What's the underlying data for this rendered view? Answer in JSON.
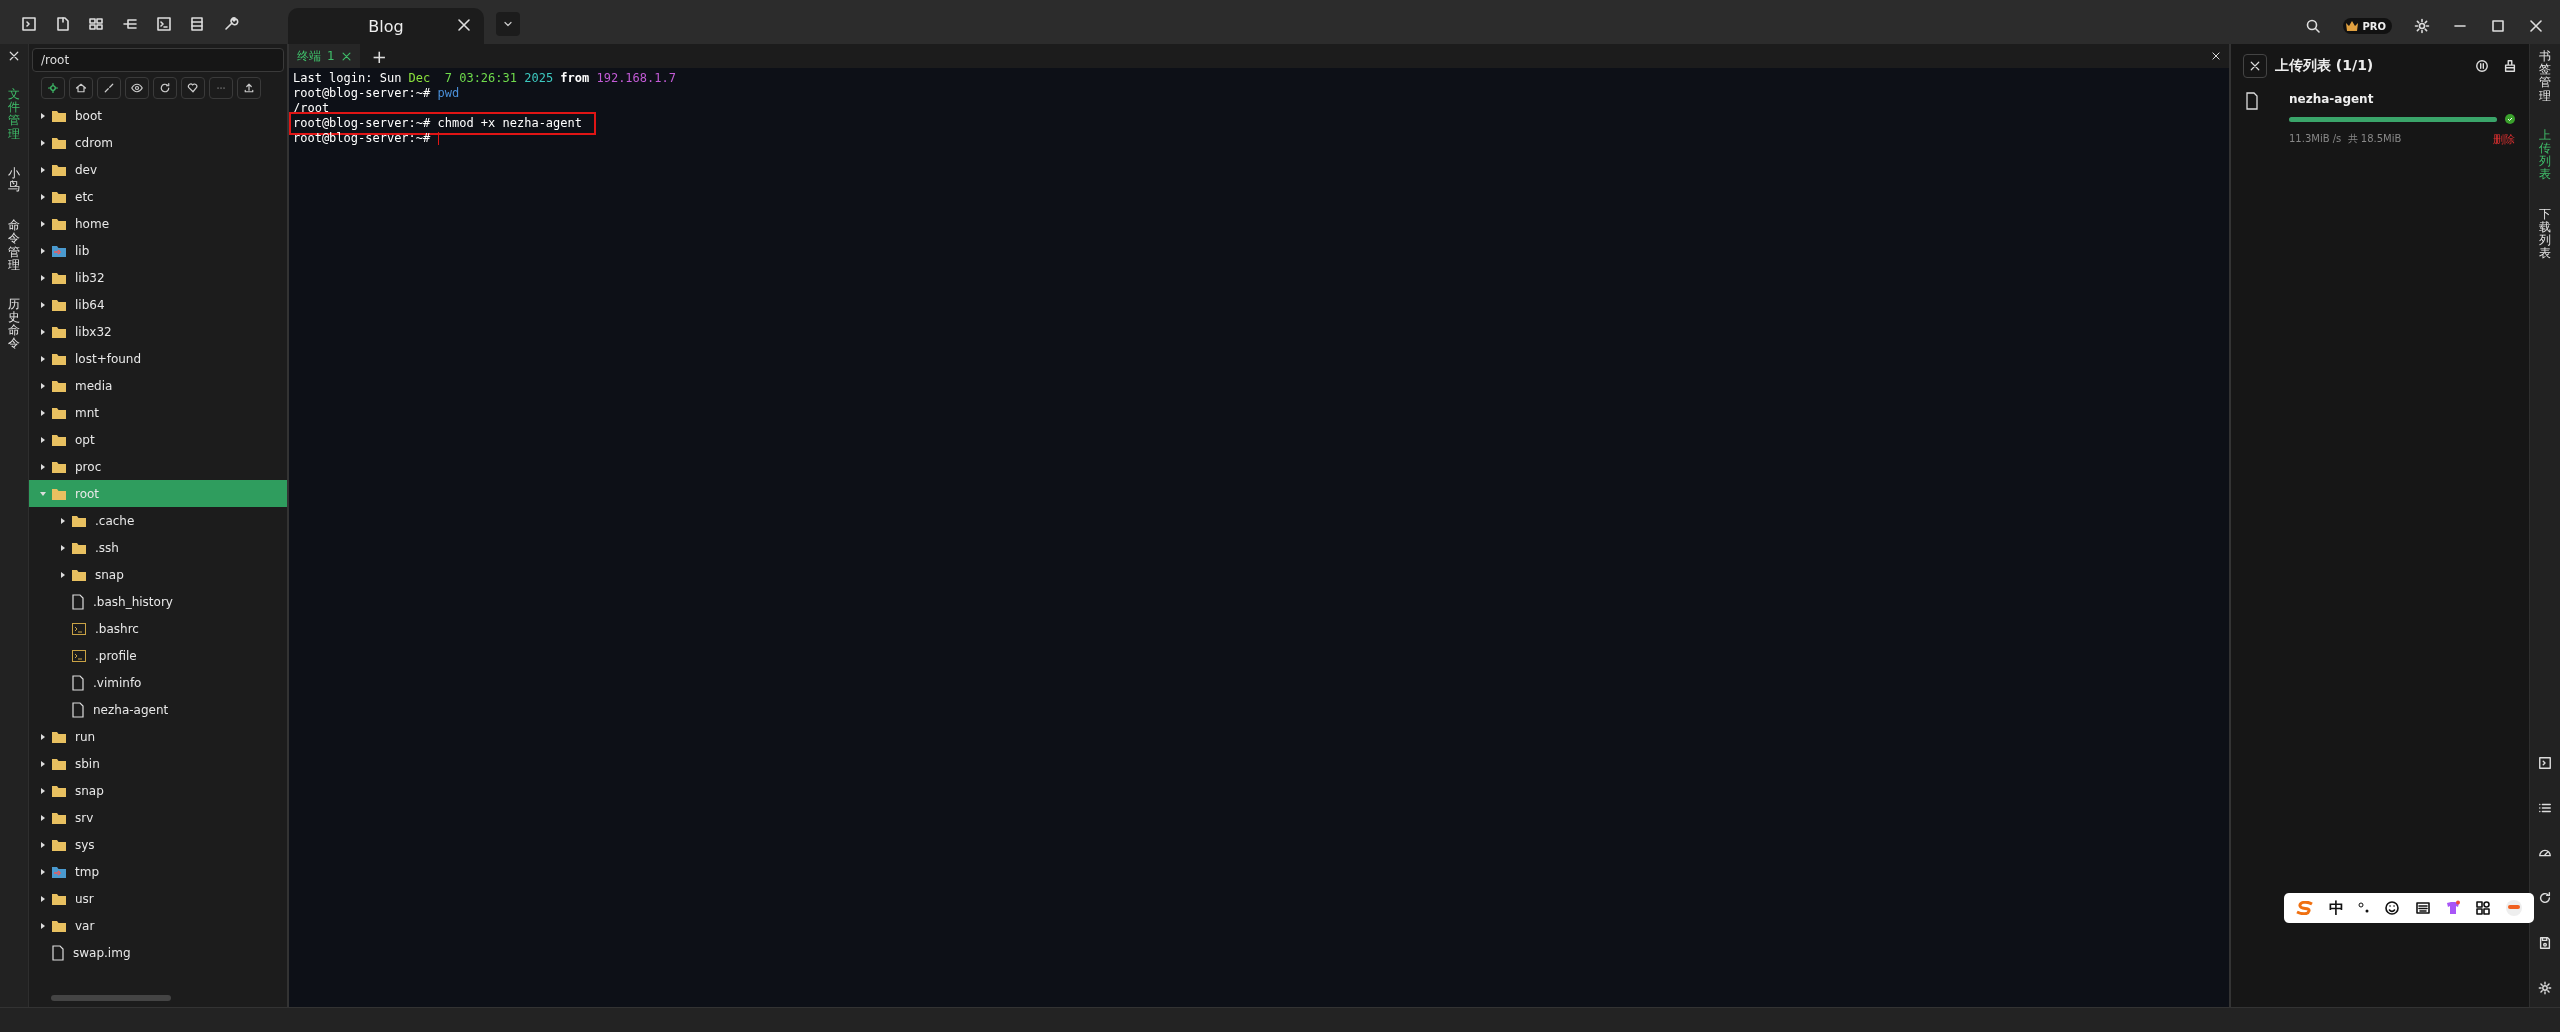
{
  "window": {
    "tab": {
      "title": "Blog",
      "selected": true
    },
    "pro_label": "PRO"
  },
  "left_tabs": [
    {
      "label": "文件管理",
      "selected": true
    },
    {
      "label": "小鸟",
      "selected": false
    },
    {
      "label": "命令管理",
      "selected": false
    },
    {
      "label": "历史命令",
      "selected": false
    }
  ],
  "file_panel": {
    "path": "/root",
    "tree": [
      {
        "name": "boot",
        "kind": "folder",
        "expanded": false,
        "selected": false
      },
      {
        "name": "cdrom",
        "kind": "folder",
        "expanded": false,
        "selected": false
      },
      {
        "name": "dev",
        "kind": "folder",
        "expanded": false,
        "selected": false
      },
      {
        "name": "etc",
        "kind": "folder",
        "expanded": false,
        "selected": false
      },
      {
        "name": "home",
        "kind": "folder",
        "expanded": false,
        "selected": false
      },
      {
        "name": "lib",
        "kind": "link",
        "expanded": false,
        "selected": false
      },
      {
        "name": "lib32",
        "kind": "folder",
        "expanded": false,
        "selected": false
      },
      {
        "name": "lib64",
        "kind": "folder",
        "expanded": false,
        "selected": false
      },
      {
        "name": "libx32",
        "kind": "folder",
        "expanded": false,
        "selected": false
      },
      {
        "name": "lost+found",
        "kind": "folder",
        "expanded": false,
        "selected": false
      },
      {
        "name": "media",
        "kind": "folder",
        "expanded": false,
        "selected": false
      },
      {
        "name": "mnt",
        "kind": "folder",
        "expanded": false,
        "selected": false
      },
      {
        "name": "opt",
        "kind": "folder",
        "expanded": false,
        "selected": false
      },
      {
        "name": "proc",
        "kind": "folder",
        "expanded": false,
        "selected": false
      },
      {
        "name": "root",
        "kind": "folder",
        "expanded": true,
        "selected": true,
        "children": [
          {
            "name": ".cache",
            "kind": "folder",
            "expanded": false,
            "selected": false
          },
          {
            "name": ".ssh",
            "kind": "folder",
            "expanded": false,
            "selected": false
          },
          {
            "name": "snap",
            "kind": "folder",
            "expanded": false,
            "selected": false
          },
          {
            "name": ".bash_history",
            "kind": "file",
            "selected": false
          },
          {
            "name": ".bashrc",
            "kind": "script",
            "selected": false
          },
          {
            "name": ".profile",
            "kind": "script",
            "selected": false
          },
          {
            "name": ".viminfo",
            "kind": "file",
            "selected": false
          },
          {
            "name": "nezha-agent",
            "kind": "file",
            "selected": false
          }
        ]
      },
      {
        "name": "run",
        "kind": "folder",
        "expanded": false,
        "selected": false
      },
      {
        "name": "sbin",
        "kind": "folder",
        "expanded": false,
        "selected": false
      },
      {
        "name": "snap",
        "kind": "folder",
        "expanded": false,
        "selected": false
      },
      {
        "name": "srv",
        "kind": "folder",
        "expanded": false,
        "selected": false
      },
      {
        "name": "sys",
        "kind": "folder",
        "expanded": false,
        "selected": false
      },
      {
        "name": "tmp",
        "kind": "link",
        "expanded": false,
        "selected": false
      },
      {
        "name": "usr",
        "kind": "folder",
        "expanded": false,
        "selected": false
      },
      {
        "name": "var",
        "kind": "folder",
        "expanded": false,
        "selected": false
      },
      {
        "name": "swap.img",
        "kind": "file",
        "selected": false
      }
    ]
  },
  "terminal": {
    "tabs": [
      {
        "label": "终端",
        "number": "1",
        "selected": true
      }
    ],
    "add": "+",
    "lines": [
      {
        "highlighted": false,
        "cursor": false,
        "segments": [
          {
            "text": "Last login: Sun ",
            "kind": "plain"
          },
          {
            "text": "Dec",
            "kind": "month"
          },
          {
            "text": "  7 03:26:31",
            "kind": "time"
          },
          {
            "text": " 2025",
            "kind": "year"
          },
          {
            "text": " from",
            "kind": "keyword"
          },
          {
            "text": " 192.168.1.7",
            "kind": "address"
          }
        ]
      },
      {
        "highlighted": false,
        "cursor": false,
        "segments": [
          {
            "text": "root@blog-server:~#",
            "kind": "plain"
          },
          {
            "text": " pwd",
            "kind": "command"
          }
        ]
      },
      {
        "highlighted": false,
        "cursor": false,
        "segments": [
          {
            "text": "/root",
            "kind": "plain"
          }
        ]
      },
      {
        "highlighted": true,
        "cursor": false,
        "segments": [
          {
            "text": "root@blog-server:~# chmod +x nezha-agent",
            "kind": "plain"
          }
        ]
      },
      {
        "highlighted": false,
        "cursor": true,
        "segments": [
          {
            "text": "root@blog-server:~#",
            "kind": "plain"
          }
        ]
      }
    ]
  },
  "upload_panel": {
    "title": "上传列表 (1/1)",
    "items": [
      {
        "name": "nezha-agent",
        "level": 1,
        "done": true,
        "stats": "11.3MiB /s  共 18.5MiB",
        "action": "删除"
      }
    ]
  },
  "right_tabs": [
    {
      "label": "书签管理",
      "selected": false
    },
    {
      "label": "上传列表",
      "selected": true
    },
    {
      "label": "下载列表",
      "selected": false
    }
  ],
  "ime_bar": {
    "mode": "中"
  }
}
